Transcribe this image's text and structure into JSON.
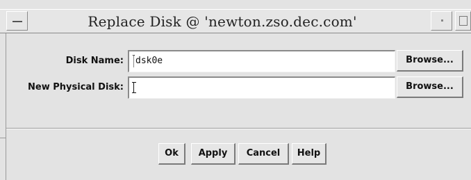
{
  "window": {
    "title": "Replace Disk @ 'newton.zso.dec.com'"
  },
  "form": {
    "disk_name_label": "Disk Name:",
    "disk_name_value": "dsk0e",
    "new_disk_label": "New Physical Disk:",
    "new_disk_value": "",
    "browse_label": "Browse..."
  },
  "buttons": {
    "ok": "Ok",
    "apply": "Apply",
    "cancel": "Cancel",
    "help": "Help"
  },
  "colors": {
    "background": "#e3e3e3",
    "field": "#ffffff"
  }
}
